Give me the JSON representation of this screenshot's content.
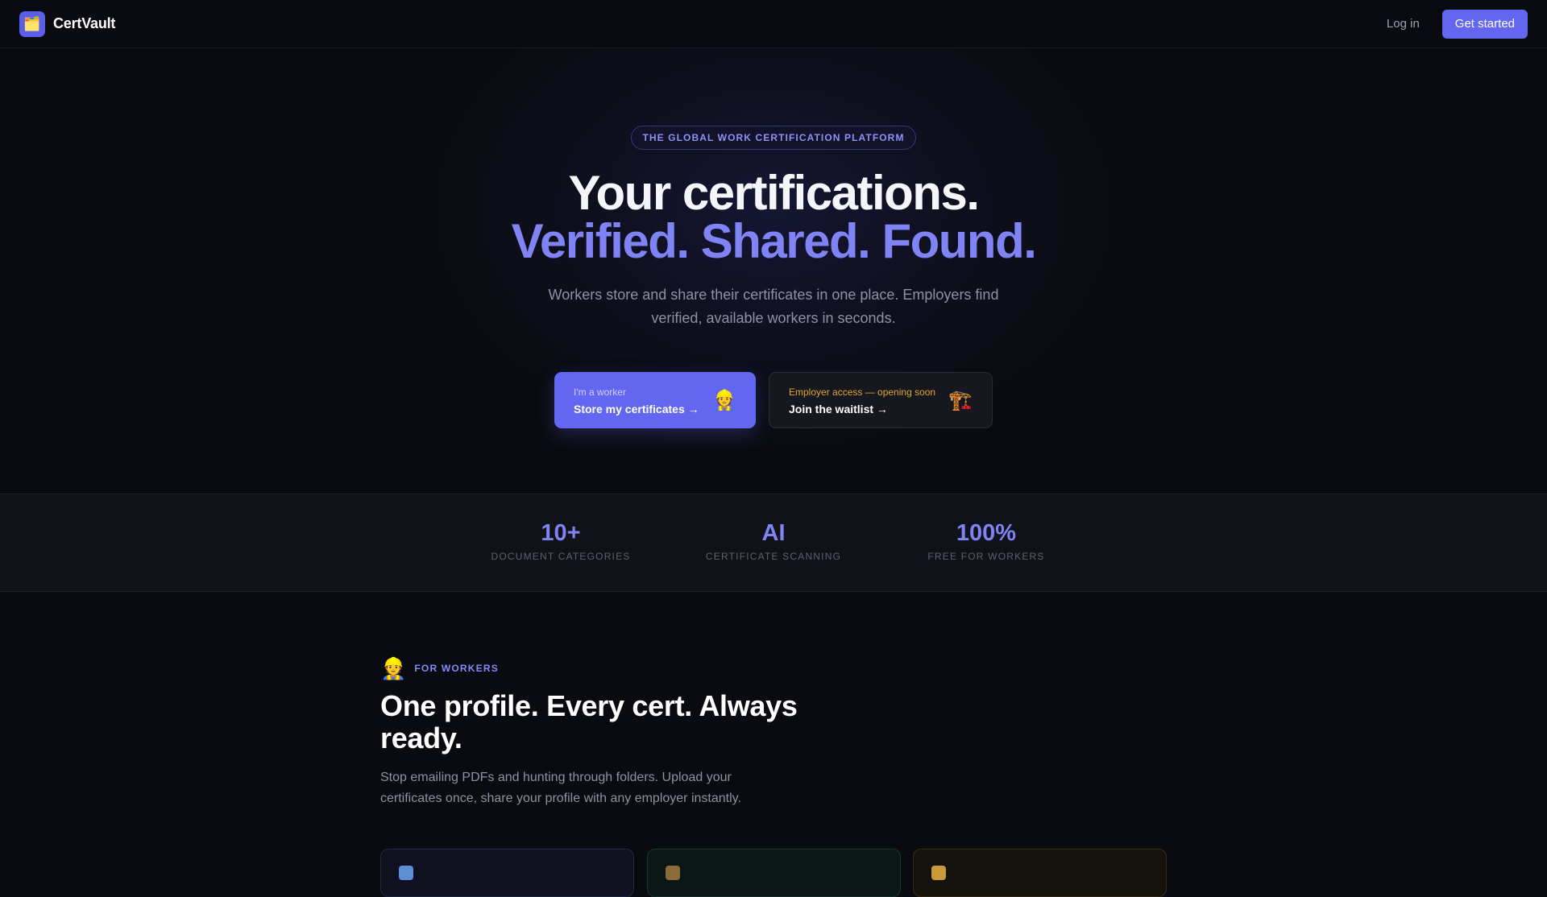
{
  "nav": {
    "brand_icon": "folder-icon",
    "brand_emoji": "🗂️",
    "brand_name": "CertVault",
    "login_label": "Log in",
    "cta_label": "Get started",
    "accent_color": "#6366f1"
  },
  "hero": {
    "eyebrow": "THE GLOBAL WORK CERTIFICATION PLATFORM",
    "title_line1": "Your certifications.",
    "title_line2": "Verified. Shared. Found.",
    "subtitle": "Workers store and share their certificates in one place. Employers find verified, available workers in seconds.",
    "worker_cta": {
      "small": "I'm a worker",
      "big": "Store my certificates →",
      "icon": "construction-worker-icon",
      "emoji": "👷"
    },
    "employer_cta": {
      "small": "Employer access — opening soon",
      "big": "Join the waitlist →",
      "icon": "crane-icon",
      "emoji": "🏗️"
    }
  },
  "stats": [
    {
      "value": "10+",
      "label": "DOCUMENT CATEGORIES"
    },
    {
      "value": "AI",
      "label": "CERTIFICATE SCANNING"
    },
    {
      "value": "100%",
      "label": "FREE FOR WORKERS"
    }
  ],
  "workers": {
    "tag_icon": "construction-worker-icon",
    "tag_emoji": "👷",
    "tag": "FOR WORKERS",
    "heading": "One profile. Every cert. Always ready.",
    "body": "Stop emailing PDFs and hunting through folders. Upload your certificates once, share your profile with any employer instantly."
  }
}
